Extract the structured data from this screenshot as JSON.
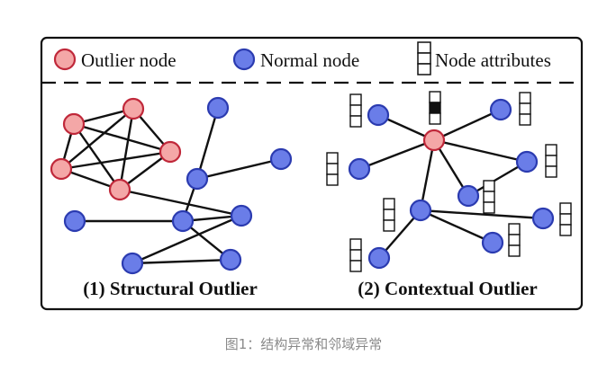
{
  "legend": {
    "outlier_label": "Outlier node",
    "normal_label": "Normal node",
    "attributes_label": "Node attributes"
  },
  "panels": [
    {
      "title": "(1) Structural Outlier"
    },
    {
      "title": "(2) Contextual Outlier"
    }
  ],
  "caption": "图1：结构异常和邻域异常",
  "colors": {
    "outlier_fill": "#f4a7a7",
    "outlier_stroke": "#c0283a",
    "normal_fill": "#6a7de8",
    "normal_stroke": "#2b3bb0",
    "edge": "#111111",
    "attribute_filled": "#111111"
  },
  "structural_graph": {
    "nodes": [
      {
        "id": "o1",
        "kind": "outlier"
      },
      {
        "id": "o2",
        "kind": "outlier"
      },
      {
        "id": "o3",
        "kind": "outlier"
      },
      {
        "id": "o4",
        "kind": "outlier"
      },
      {
        "id": "o5",
        "kind": "outlier"
      },
      {
        "id": "n1",
        "kind": "normal"
      },
      {
        "id": "n2",
        "kind": "normal"
      },
      {
        "id": "n3",
        "kind": "normal"
      },
      {
        "id": "n4",
        "kind": "normal"
      },
      {
        "id": "n5",
        "kind": "normal"
      },
      {
        "id": "n6",
        "kind": "normal"
      },
      {
        "id": "n7",
        "kind": "normal"
      },
      {
        "id": "n8",
        "kind": "normal"
      }
    ],
    "edges": [
      [
        "o1",
        "o2"
      ],
      [
        "o1",
        "o3"
      ],
      [
        "o1",
        "o4"
      ],
      [
        "o1",
        "o5"
      ],
      [
        "o2",
        "o3"
      ],
      [
        "o2",
        "o4"
      ],
      [
        "o2",
        "o5"
      ],
      [
        "o3",
        "o4"
      ],
      [
        "o3",
        "o5"
      ],
      [
        "o4",
        "o5"
      ],
      [
        "o5",
        "n6"
      ],
      [
        "n1",
        "n2"
      ],
      [
        "n2",
        "n3"
      ],
      [
        "n2",
        "n5"
      ],
      [
        "n4",
        "n5"
      ],
      [
        "n5",
        "n6"
      ],
      [
        "n5",
        "n8"
      ],
      [
        "n6",
        "n7"
      ],
      [
        "n7",
        "n8"
      ]
    ]
  },
  "contextual_graph": {
    "nodes": [
      {
        "id": "c0",
        "kind": "outlier"
      },
      {
        "id": "c1",
        "kind": "normal"
      },
      {
        "id": "c2",
        "kind": "normal"
      },
      {
        "id": "c3",
        "kind": "normal"
      },
      {
        "id": "c4",
        "kind": "normal"
      },
      {
        "id": "c5",
        "kind": "normal"
      },
      {
        "id": "c6",
        "kind": "normal"
      },
      {
        "id": "c7",
        "kind": "normal"
      },
      {
        "id": "c8",
        "kind": "normal"
      },
      {
        "id": "c9",
        "kind": "normal"
      }
    ],
    "edges": [
      [
        "c0",
        "c1"
      ],
      [
        "c0",
        "c2"
      ],
      [
        "c0",
        "c3"
      ],
      [
        "c0",
        "c4"
      ],
      [
        "c0",
        "c5"
      ],
      [
        "c0",
        "c6"
      ],
      [
        "c6",
        "c7"
      ],
      [
        "c6",
        "c8"
      ],
      [
        "c6",
        "c9"
      ],
      [
        "c4",
        "c5"
      ]
    ],
    "attribute_stacks": [
      {
        "pattern": [
          0,
          0,
          0
        ]
      },
      {
        "pattern": [
          0,
          1,
          0
        ]
      },
      {
        "pattern": [
          0,
          0,
          0
        ]
      },
      {
        "pattern": [
          0,
          0,
          0
        ]
      },
      {
        "pattern": [
          0,
          0,
          0
        ]
      },
      {
        "pattern": [
          0,
          0,
          0
        ]
      },
      {
        "pattern": [
          0,
          0,
          0
        ]
      },
      {
        "pattern": [
          0,
          0,
          0
        ]
      },
      {
        "pattern": [
          0,
          0,
          0
        ]
      },
      {
        "pattern": [
          0,
          0,
          0
        ]
      },
      {
        "pattern": [
          0,
          0,
          0
        ]
      }
    ]
  }
}
